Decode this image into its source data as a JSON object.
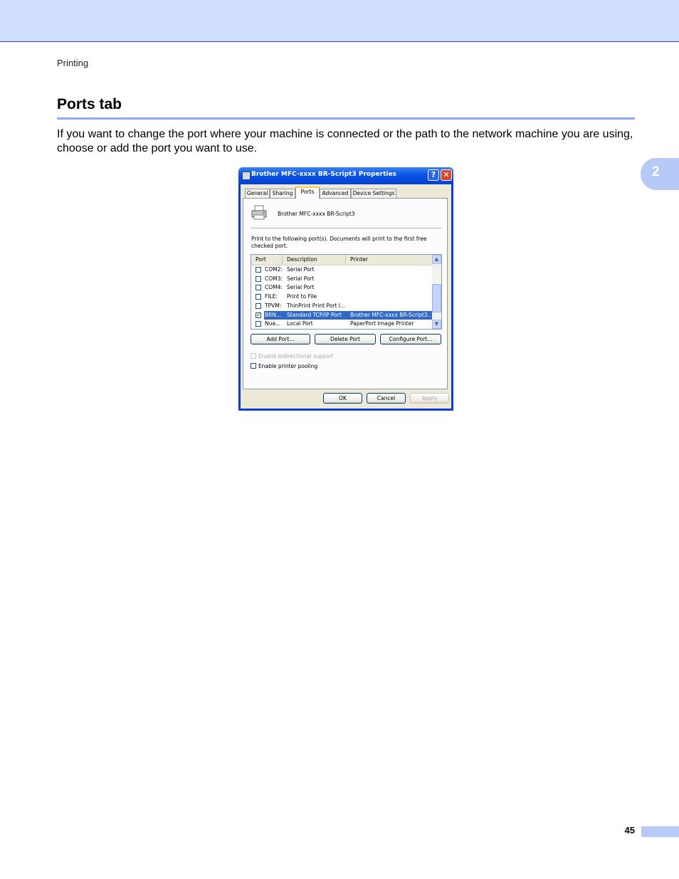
{
  "page": {
    "breadcrumb": "Printing",
    "section_title": "Ports tab",
    "body_text": "If you want to change the port where your machine is connected or the path to the network machine you are using, choose or add the port you want to use.",
    "chapter_number": "2",
    "page_number": "45"
  },
  "colors": {
    "header_band": "#cfdeff",
    "accent_rule": "#8fa9f5",
    "chapter_tab": "#b7c9f7"
  },
  "dialog": {
    "title": "Brother MFC-xxxx BR-Script3 Properties",
    "help_glyph": "?",
    "close_glyph": "✕",
    "tabs": [
      "General",
      "Sharing",
      "Ports",
      "Advanced",
      "Device Settings"
    ],
    "active_tab": "Ports",
    "printer_name": "Brother MFC-xxxx BR-Script3",
    "instruction": "Print to the following port(s). Documents will print to the first free checked port.",
    "columns": [
      "Port",
      "Description",
      "Printer"
    ],
    "rows": [
      {
        "port": "COM2:",
        "description": "Serial Port",
        "printer": "",
        "checked": false,
        "selected": false
      },
      {
        "port": "COM3:",
        "description": "Serial Port",
        "printer": "",
        "checked": false,
        "selected": false
      },
      {
        "port": "COM4:",
        "description": "Serial Port",
        "printer": "",
        "checked": false,
        "selected": false
      },
      {
        "port": "FILE:",
        "description": "Print to File",
        "printer": "",
        "checked": false,
        "selected": false
      },
      {
        "port": "TPVM:",
        "description": "ThinPrint Print Port I...",
        "printer": "",
        "checked": false,
        "selected": false
      },
      {
        "port": "BRN...",
        "description": "Standard TCP/IP Port",
        "printer": "Brother MFC-xxxx BR-Script3...",
        "checked": true,
        "selected": true
      },
      {
        "port": "Nua...",
        "description": "Local Port",
        "printer": "PaperPort Image Printer",
        "checked": false,
        "selected": false
      }
    ],
    "scroll_up_glyph": "▲",
    "scroll_down_glyph": "▼",
    "add_port": "Add Port...",
    "delete_port": "Delete Port",
    "configure_port": "Configure Port...",
    "bidirectional": "Enable bidirectional support",
    "pooling": "Enable printer pooling",
    "ok": "OK",
    "cancel": "Cancel",
    "apply": "Apply"
  }
}
